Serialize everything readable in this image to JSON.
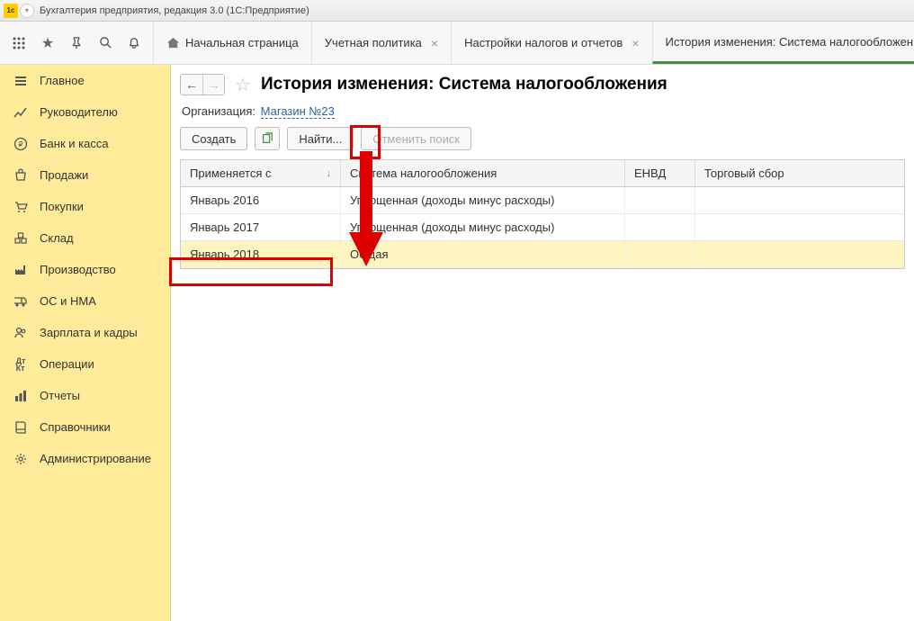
{
  "window": {
    "title": "Бухгалтерия предприятия, редакция 3.0  (1С:Предприятие)"
  },
  "tabs": {
    "home": "Начальная страница",
    "items": [
      {
        "label": "Учетная политика"
      },
      {
        "label": "Настройки налогов и отчетов"
      },
      {
        "label": "История изменения: Система налогообложения",
        "active": true
      }
    ]
  },
  "sidebar": {
    "items": [
      {
        "label": "Главное",
        "icon": "menu"
      },
      {
        "label": "Руководителю",
        "icon": "chart"
      },
      {
        "label": "Банк и касса",
        "icon": "ruble"
      },
      {
        "label": "Продажи",
        "icon": "bag"
      },
      {
        "label": "Покупки",
        "icon": "cart"
      },
      {
        "label": "Склад",
        "icon": "boxes"
      },
      {
        "label": "Производство",
        "icon": "factory"
      },
      {
        "label": "ОС и НМА",
        "icon": "truck"
      },
      {
        "label": "Зарплата и кадры",
        "icon": "people"
      },
      {
        "label": "Операции",
        "icon": "dtkt"
      },
      {
        "label": "Отчеты",
        "icon": "bars"
      },
      {
        "label": "Справочники",
        "icon": "book"
      },
      {
        "label": "Администрирование",
        "icon": "gear"
      }
    ]
  },
  "page": {
    "title": "История изменения: Система налогообложения",
    "org_label": "Организация:",
    "org_value": "Магазин №23",
    "buttons": {
      "create": "Создать",
      "find": "Найти...",
      "cancel_search": "Отменить поиск"
    },
    "columns": {
      "applied_from": "Применяется с",
      "tax_system": "Система налогообложения",
      "envd": "ЕНВД",
      "trade_fee": "Торговый сбор"
    },
    "rows": [
      {
        "applied_from": "Январь 2016",
        "tax_system": "Упрощенная (доходы минус расходы)",
        "envd": "",
        "trade_fee": ""
      },
      {
        "applied_from": "Январь 2017",
        "tax_system": "Упрощенная (доходы минус расходы)",
        "envd": "",
        "trade_fee": ""
      },
      {
        "applied_from": "Январь 2018",
        "tax_system": "Общая",
        "envd": "",
        "trade_fee": "",
        "highlighted": true
      }
    ]
  }
}
